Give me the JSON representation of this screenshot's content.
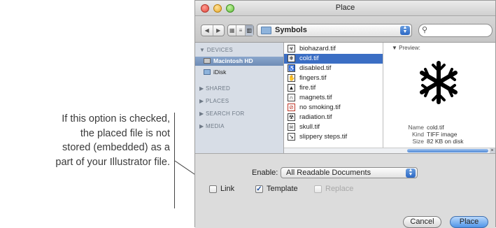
{
  "annotation": {
    "lines": [
      "If this option is checked,",
      "the placed file is not",
      "stored (embedded) as a",
      "part of your Illustrator file."
    ]
  },
  "window": {
    "title": "Place",
    "current_folder": "Symbols",
    "search_placeholder": ""
  },
  "sidebar": {
    "sections": [
      {
        "label": "▼ DEVICES"
      },
      {
        "label": "▶ SHARED"
      },
      {
        "label": "▶ PLACES"
      },
      {
        "label": "▶ SEARCH FOR"
      },
      {
        "label": "▶ MEDIA"
      }
    ],
    "devices": [
      {
        "label": "Macintosh HD",
        "selected": true
      },
      {
        "label": "iDisk",
        "selected": false
      }
    ]
  },
  "files": [
    {
      "name": "biohazard.tif",
      "icon": "biohazard-icon",
      "glyph": "☣"
    },
    {
      "name": "cold.tif",
      "icon": "snowflake-icon",
      "glyph": "❄",
      "selected": true
    },
    {
      "name": "disabled.tif",
      "icon": "wheelchair-icon",
      "glyph": "♿"
    },
    {
      "name": "fingers.tif",
      "icon": "hand-icon",
      "glyph": "✋"
    },
    {
      "name": "fire.tif",
      "icon": "fire-icon",
      "glyph": "▲"
    },
    {
      "name": "magnets.tif",
      "icon": "magnet-icon",
      "glyph": "∩"
    },
    {
      "name": "no smoking.tif",
      "icon": "no-smoking-icon",
      "glyph": "⊘"
    },
    {
      "name": "radiation.tif",
      "icon": "radiation-icon",
      "glyph": "☢"
    },
    {
      "name": "skull.tif",
      "icon": "skull-icon",
      "glyph": "☠"
    },
    {
      "name": "slippery steps.tif",
      "icon": "slippery-steps-icon",
      "glyph": "↘"
    }
  ],
  "preview": {
    "label": "▼ Preview:",
    "image_icon": "snowflake-icon",
    "name_key": "Name",
    "name_value": "cold.tif",
    "kind_key": "Kind",
    "kind_value": "TIFF image",
    "size_key": "Size",
    "size_value": "82 KB on disk"
  },
  "options": {
    "enable_label": "Enable:",
    "enable_value": "All Readable Documents",
    "link_label": "Link",
    "link_checked": false,
    "template_label": "Template",
    "template_checked": true,
    "replace_label": "Replace",
    "replace_checked": false,
    "replace_enabled": false
  },
  "buttons": {
    "cancel": "Cancel",
    "place": "Place"
  },
  "colors": {
    "selection_blue": "#3b6ec4",
    "sidebar_bg": "#d7dde6",
    "primary_button": "#4f95e8"
  }
}
